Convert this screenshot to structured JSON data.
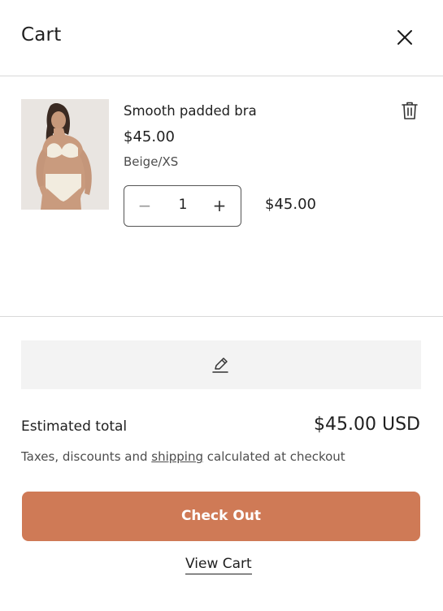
{
  "header": {
    "title": "Cart",
    "close_icon": "close-icon"
  },
  "item": {
    "name": "Smooth padded bra",
    "price": "$45.00",
    "variant": "Beige/XS",
    "quantity": "1",
    "line_total": "$45.00",
    "image_icon": "product-photo",
    "remove_icon": "trash-icon",
    "qty_minus": "−",
    "qty_plus": "+"
  },
  "note": {
    "icon": "pencil-icon"
  },
  "summary": {
    "estimated_label": "Estimated total",
    "estimated_value": "$45.00 USD",
    "taxes_prefix": "Taxes, discounts and ",
    "taxes_link": "shipping",
    "taxes_suffix": " calculated at checkout"
  },
  "actions": {
    "checkout_label": "Check Out",
    "view_cart_label": "View Cart"
  },
  "colors": {
    "checkout_bg": "#cf7a56",
    "divider": "#d9d9d9",
    "note_bg": "#f3f3f3"
  }
}
